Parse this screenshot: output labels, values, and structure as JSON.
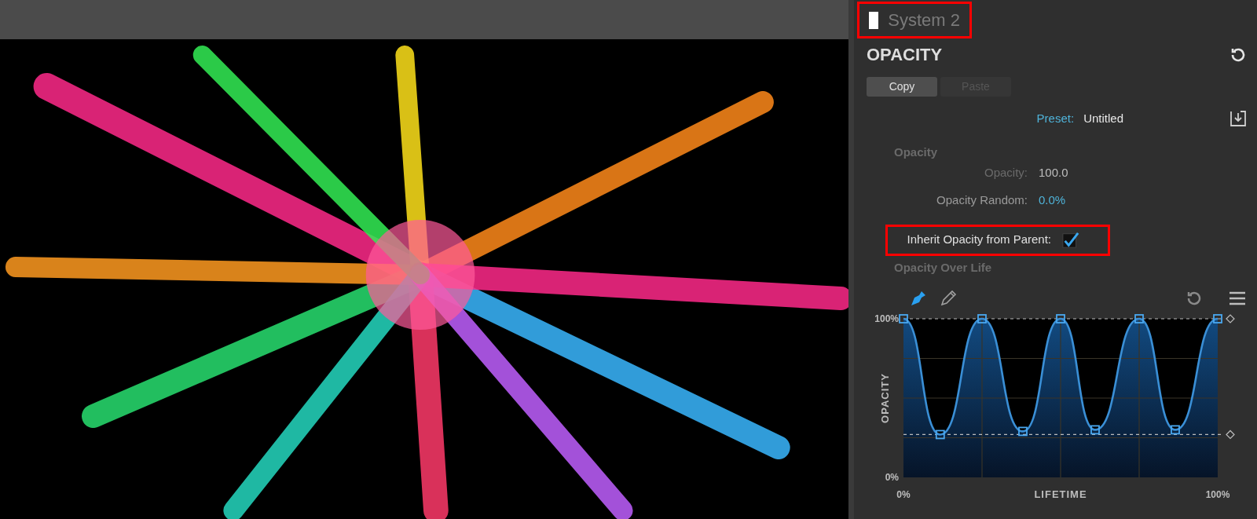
{
  "panel": {
    "system": {
      "name": "System 2",
      "highlighted": true
    },
    "section_title": "OPACITY",
    "buttons": [
      {
        "label": "Copy",
        "disabled": false
      },
      {
        "label": "Paste",
        "disabled": true
      }
    ],
    "preset": {
      "label": "Preset:",
      "value": "Untitled"
    },
    "opacity_group": {
      "title": "Opacity",
      "fields": [
        {
          "kind": "value",
          "label": "Opacity:",
          "value": "100.0",
          "disabled": true
        },
        {
          "kind": "value",
          "label": "Opacity Random:",
          "value": "0.0%",
          "disabled": false
        },
        {
          "kind": "checkbox",
          "label": "Inherit Opacity from Parent:",
          "checked": true,
          "highlighted": true
        }
      ]
    },
    "curve_group": {
      "title": "Opacity Over Life",
      "tools": [
        {
          "kind": "pen",
          "selected": true
        },
        {
          "kind": "pencil",
          "selected": false
        }
      ],
      "chart_data": {
        "type": "area",
        "xlabel": "LIFETIME",
        "ylabel": "OPACITY",
        "x": [
          0,
          11.7,
          25,
          38,
          50,
          61,
          75,
          86.5,
          100
        ],
        "series": [
          {
            "color": "#3a8fd6",
            "values": [
              100,
              27,
              100,
              29,
              100,
              30,
              100,
              30,
              100
            ]
          }
        ],
        "ref_lines": [
          {
            "axis": "y",
            "value": 100
          },
          {
            "axis": "y",
            "value": 27
          }
        ],
        "xlim": [
          0,
          100
        ],
        "ylim": [
          0,
          100
        ],
        "xticks": [
          {
            "value": 0,
            "label": "0%"
          },
          {
            "value": 100,
            "label": "100%"
          }
        ],
        "yticks": [
          {
            "value": 0,
            "label": "0%"
          },
          {
            "value": 100,
            "label": "100%"
          }
        ]
      }
    }
  }
}
